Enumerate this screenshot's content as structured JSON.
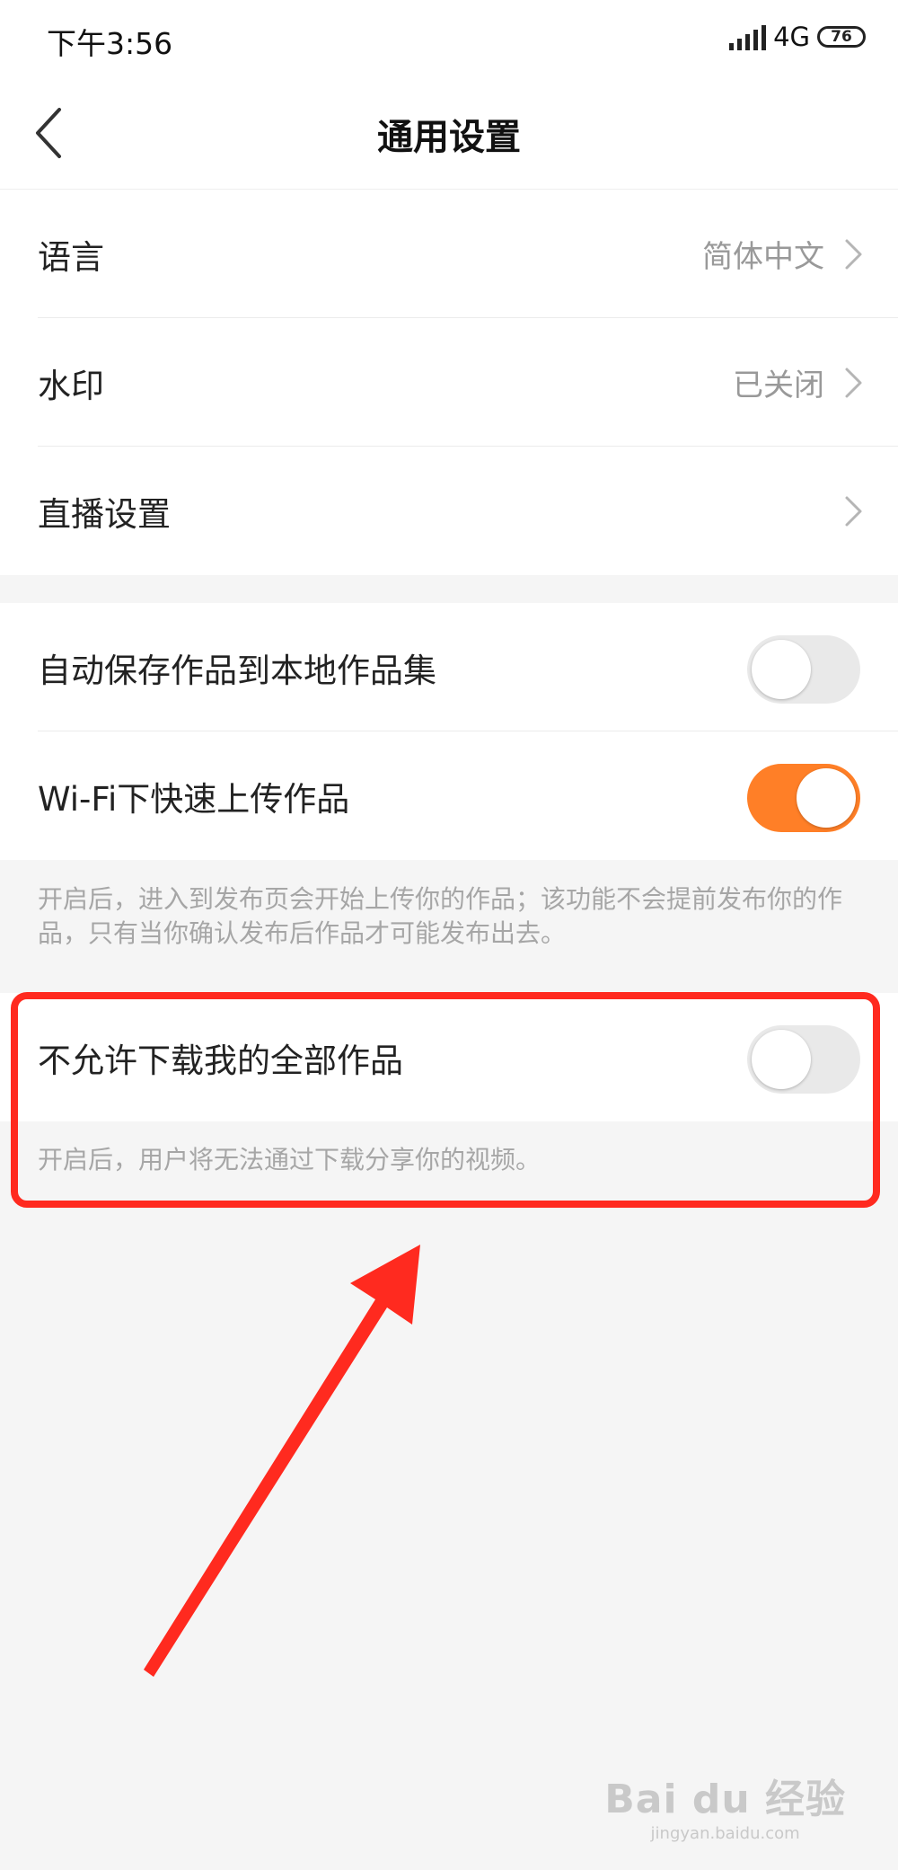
{
  "status_bar": {
    "time": "下午3:56",
    "network": "4G",
    "battery": "76"
  },
  "nav": {
    "title": "通用设置"
  },
  "group1": [
    {
      "label": "语言",
      "value": "简体中文"
    },
    {
      "label": "水印",
      "value": "已关闭"
    },
    {
      "label": "直播设置",
      "value": ""
    }
  ],
  "group2": [
    {
      "label": "自动保存作品到本地作品集",
      "state": "off"
    },
    {
      "label": "Wi-Fi下快速上传作品",
      "state": "on"
    }
  ],
  "group2_hint": "开启后，进入到发布页会开始上传你的作品；该功能不会提前发布你的作品，只有当你确认发布后作品才可能发布出去。",
  "group3": {
    "label": "不允许下载我的全部作品",
    "state": "off"
  },
  "group3_hint": "开启后，用户将无法通过下载分享你的视频。",
  "watermark": {
    "main": "Bai du 经验",
    "sub": "jingyan.baidu.com"
  },
  "colors": {
    "accent": "#ff7f27",
    "annotation": "#ff2a1f",
    "background": "#f5f5f5"
  }
}
